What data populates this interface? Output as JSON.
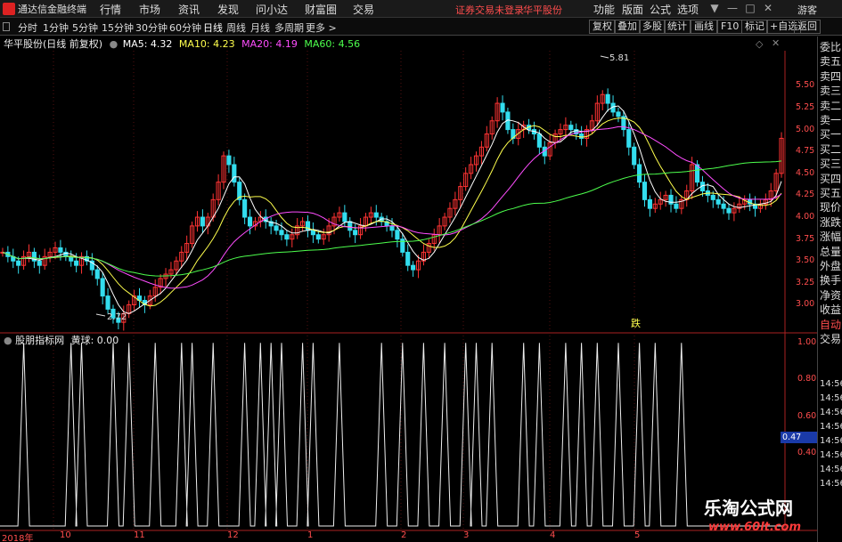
{
  "app": {
    "title": "通达信金融终端"
  },
  "menu": [
    "行情",
    "市场",
    "资讯",
    "发现",
    "问小达",
    "财富圈",
    "交易"
  ],
  "status": {
    "login": "证券交易未登录",
    "stock": "华平股份"
  },
  "right_menu": [
    "功能",
    "版面",
    "公式",
    "选项"
  ],
  "window_buttons": {
    "menu": "▼",
    "min": "—",
    "max": "□",
    "close": "✕"
  },
  "guest": "游客",
  "periods": [
    "分时",
    "1分钟",
    "5分钟",
    "15分钟",
    "30分钟",
    "60分钟",
    "日线",
    "周线",
    "月线",
    "多周期",
    "更多 >"
  ],
  "active_period": "日线",
  "right_tools": [
    "复权",
    "叠加",
    "多股",
    "统计",
    "画线",
    "F10",
    "标记",
    "+自选",
    "返回"
  ],
  "chart_header": {
    "stock": "华平股份(日线 前复权)",
    "ma5": "MA5: 4.32",
    "ma10": "MA10: 4.23",
    "ma20": "MA20: 4.19",
    "ma60": "MA60: 4.56"
  },
  "sub_header": {
    "name": "股朋指标网",
    "value": "黄球: 0.00"
  },
  "side_panel": [
    "委比",
    "卖五",
    "卖四",
    "卖三",
    "卖二",
    "卖一",
    "买一",
    "买二",
    "买三",
    "买四",
    "买五",
    "现价",
    "涨跌",
    "涨幅",
    "总量",
    "外盘",
    "换手",
    "净资",
    "收益",
    "自动",
    "交易"
  ],
  "side_times": [
    "14:56",
    "14:56",
    "14:56",
    "14:56",
    "14:56",
    "14:56",
    "14:56",
    "14:56"
  ],
  "price_labels": [
    "5.50",
    "5.25",
    "5.00",
    "4.75",
    "4.50",
    "4.25",
    "4.00",
    "3.75",
    "3.50",
    "3.25",
    "3.00"
  ],
  "sub_labels": [
    "1.00",
    "0.80",
    "0.60",
    "0.40"
  ],
  "current_value": "0.47",
  "annotations": {
    "high": "5.81",
    "low": "2.72",
    "event": "跌"
  },
  "dates": [
    "2018年",
    "10",
    "11",
    "12",
    "1",
    "2",
    "3",
    "4",
    "5"
  ],
  "watermark": {
    "title": "乐淘公式网",
    "url": "www.60lt.com"
  },
  "chart_data": {
    "type": "candlestick",
    "price_ylim": [
      2.7,
      5.9
    ],
    "high": 5.81,
    "low": 2.72,
    "ma_last": {
      "MA5": 4.32,
      "MA10": 4.23,
      "MA20": 4.19,
      "MA60": 4.56
    },
    "close": [
      3.6,
      3.55,
      3.5,
      3.45,
      3.55,
      3.6,
      3.5,
      3.45,
      3.55,
      3.6,
      3.65,
      3.6,
      3.55,
      3.5,
      3.45,
      3.55,
      3.5,
      3.4,
      3.3,
      3.1,
      2.95,
      2.85,
      2.8,
      2.9,
      3.0,
      3.1,
      3.05,
      3.0,
      3.1,
      3.2,
      3.3,
      3.35,
      3.4,
      3.5,
      3.6,
      3.7,
      3.9,
      4.0,
      3.9,
      4.0,
      4.2,
      4.4,
      4.7,
      4.6,
      4.4,
      4.2,
      4.0,
      3.9,
      3.95,
      4.0,
      3.95,
      3.9,
      3.85,
      3.8,
      3.75,
      3.8,
      3.9,
      3.95,
      3.85,
      3.8,
      3.75,
      3.8,
      3.9,
      4.0,
      4.05,
      3.95,
      3.85,
      3.8,
      3.9,
      4.0,
      4.05,
      4.0,
      3.95,
      3.9,
      3.85,
      3.75,
      3.6,
      3.45,
      3.4,
      3.5,
      3.6,
      3.7,
      3.8,
      3.9,
      4.0,
      4.1,
      4.2,
      4.35,
      4.5,
      4.6,
      4.7,
      4.8,
      4.95,
      5.1,
      5.3,
      5.2,
      5.0,
      4.9,
      5.0,
      5.05,
      5.0,
      4.95,
      4.8,
      4.7,
      4.85,
      4.95,
      5.0,
      5.05,
      5.0,
      4.95,
      4.9,
      5.0,
      5.1,
      5.3,
      5.4,
      5.3,
      5.2,
      5.15,
      5.0,
      4.8,
      4.6,
      4.4,
      4.2,
      4.1,
      4.15,
      4.2,
      4.25,
      4.15,
      4.1,
      4.2,
      4.3,
      4.6,
      4.4,
      4.3,
      4.25,
      4.2,
      4.15,
      4.1,
      4.05,
      4.1,
      4.15,
      4.2,
      4.15,
      4.1,
      4.15,
      4.2,
      4.3,
      4.5,
      4.9
    ],
    "spike_index": [
      4,
      13,
      15,
      21,
      24,
      29,
      34,
      36,
      40,
      46,
      49,
      51,
      53,
      57,
      59,
      64,
      72,
      76,
      80,
      84,
      88,
      90,
      93,
      99,
      102,
      107,
      110,
      113,
      117,
      121,
      124,
      129
    ],
    "sub_ylim": [
      0,
      1.05
    ],
    "current_value": 0.47
  }
}
